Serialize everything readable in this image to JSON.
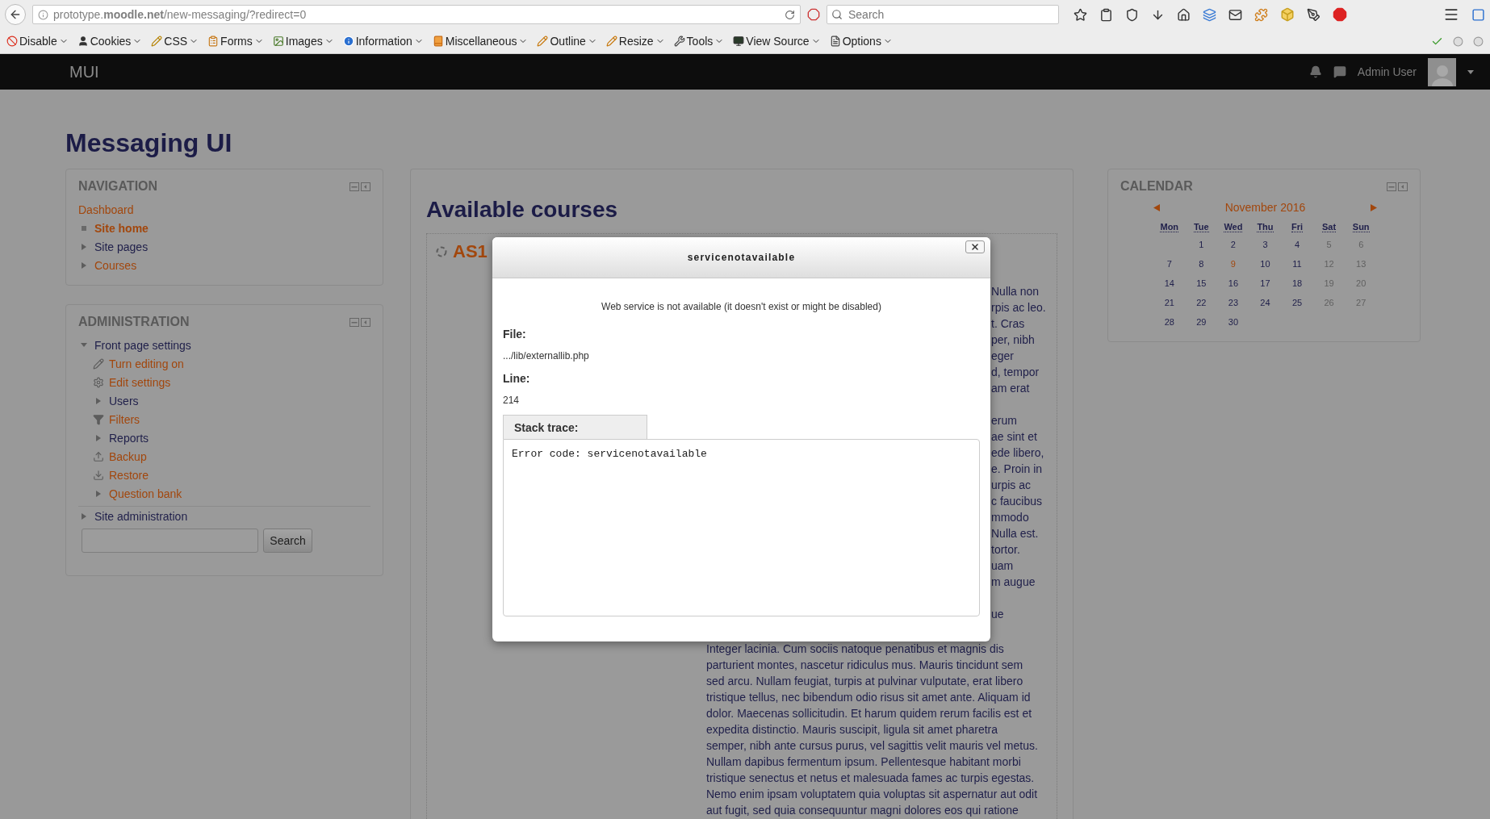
{
  "browser": {
    "url": "prototype.**moodle.net**/new-messaging/?redirect=0",
    "search_placeholder": "Search",
    "toolbar": [
      {
        "label": "Disable",
        "kind": "disable"
      },
      {
        "label": "Cookies",
        "kind": "cookies"
      },
      {
        "label": "CSS",
        "kind": "css"
      },
      {
        "label": "Forms",
        "kind": "forms"
      },
      {
        "label": "Images",
        "kind": "images"
      },
      {
        "label": "Information",
        "kind": "information"
      },
      {
        "label": "Miscellaneous",
        "kind": "misc"
      },
      {
        "label": "Outline",
        "kind": "outline"
      },
      {
        "label": "Resize",
        "kind": "resize"
      },
      {
        "label": "Tools",
        "kind": "tools"
      },
      {
        "label": "View Source",
        "kind": "source"
      },
      {
        "label": "Options",
        "kind": "options"
      }
    ]
  },
  "navbar": {
    "brand": "MUI",
    "user": "Admin User"
  },
  "page_title": "Messaging UI",
  "navigation": {
    "title": "NAVIGATION",
    "items": [
      {
        "label": "Dashboard",
        "kind": "plain",
        "link": true,
        "selected": false
      },
      {
        "label": "Site home",
        "kind": "leaf",
        "link": true,
        "selected": true
      },
      {
        "label": "Site pages",
        "kind": "branch",
        "link": false,
        "selected": false
      },
      {
        "label": "Courses",
        "kind": "branch",
        "link": true,
        "selected": false
      }
    ]
  },
  "administration": {
    "title": "ADMINISTRATION",
    "items": [
      {
        "label": "Front page settings",
        "kind": "branch",
        "link": false,
        "expanded": true,
        "children": [
          {
            "label": "Turn editing on",
            "kind": "edit",
            "link": true
          },
          {
            "label": "Edit settings",
            "kind": "settings",
            "link": true
          },
          {
            "label": "Users",
            "kind": "branch",
            "link": false,
            "expanded": false
          },
          {
            "label": "Filters",
            "kind": "filter",
            "link": true
          },
          {
            "label": "Reports",
            "kind": "branch",
            "link": false,
            "expanded": false
          },
          {
            "label": "Backup",
            "kind": "backup",
            "link": true
          },
          {
            "label": "Restore",
            "kind": "restore",
            "link": true
          },
          {
            "label": "Question bank",
            "kind": "branch",
            "link": true,
            "expanded": false
          }
        ]
      },
      {
        "label": "Site administration",
        "kind": "branch",
        "link": false,
        "expanded": false
      }
    ],
    "search_button": "Search"
  },
  "main": {
    "heading": "Available courses",
    "course": {
      "title": "AS1",
      "fragments": [
        [
          "Nulla non",
          "rpis ac leo.",
          "t. Cras",
          "per, nibh",
          "eger",
          "d, tempor",
          "am erat"
        ],
        [
          "erum",
          "ae sint et",
          "ede libero,",
          "e. Proin in",
          "urpis ac",
          "c faucibus",
          "mmodo",
          "Nulla est.",
          "tortor.",
          "uam",
          "m augue"
        ],
        [
          "ue"
        ]
      ],
      "paragraph": [
        "Integer lacinia. Cum sociis natoque penatibus et magnis dis",
        "parturient montes, nascetur ridiculus mus. Mauris tincidunt sem",
        "sed arcu. Nullam feugiat, turpis at pulvinar vulputate, erat libero",
        "tristique tellus, nec bibendum odio risus sit amet ante. Aliquam id",
        "dolor. Maecenas sollicitudin. Et harum quidem rerum facilis est et",
        "expedita distinctio. Mauris suscipit, ligula sit amet pharetra",
        "semper, nibh ante cursus purus, vel sagittis velit mauris vel metus.",
        "Nullam dapibus fermentum ipsum. Pellentesque habitant morbi",
        "tristique senectus et netus et malesuada fames ac turpis egestas.",
        "Nemo enim ipsam voluptatem quia voluptas sit aspernatur aut odit",
        "aut fugit, sed quia consequuntur magni dolores eos qui ratione"
      ]
    }
  },
  "calendar": {
    "title": "CALENDAR",
    "month": "November 2016",
    "weekdays": [
      "Mon",
      "Tue",
      "Wed",
      "Thu",
      "Fri",
      "Sat",
      "Sun"
    ],
    "weeks": [
      {
        "days": [
          {
            "label": "1",
            "today": false
          },
          {
            "label": "2",
            "today": false
          },
          {
            "label": "3",
            "today": false
          },
          {
            "label": "4",
            "today": false
          },
          {
            "label": "5",
            "today": false
          },
          {
            "label": "6",
            "today": false
          }
        ]
      },
      {
        "days": [
          {
            "label": "7",
            "today": false
          },
          {
            "label": "8",
            "today": false
          },
          {
            "label": "9",
            "today": true
          },
          {
            "label": "10",
            "today": false
          },
          {
            "label": "11",
            "today": false
          },
          {
            "label": "12",
            "today": false
          },
          {
            "label": "13",
            "today": false
          }
        ]
      },
      {
        "days": [
          {
            "label": "14",
            "today": false
          },
          {
            "label": "15",
            "today": false
          },
          {
            "label": "16",
            "today": false
          },
          {
            "label": "17",
            "today": false
          },
          {
            "label": "18",
            "today": false
          },
          {
            "label": "19",
            "today": false
          },
          {
            "label": "20",
            "today": false
          }
        ]
      },
      {
        "days": [
          {
            "label": "21",
            "today": false
          },
          {
            "label": "22",
            "today": false
          },
          {
            "label": "23",
            "today": false
          },
          {
            "label": "24",
            "today": false
          },
          {
            "label": "25",
            "today": false
          },
          {
            "label": "26",
            "today": false
          },
          {
            "label": "27",
            "today": false
          }
        ]
      },
      {
        "days": [
          {
            "label": "28",
            "today": false
          },
          {
            "label": "29",
            "today": false
          },
          {
            "label": "30",
            "today": false
          }
        ]
      }
    ]
  },
  "dialog": {
    "title": "servicenotavailable",
    "message": "Web service is not available (it doesn't exist or might be disabled)",
    "file_label": "File:",
    "file": ".../lib/externallib.php",
    "line_label": "Line:",
    "line": "214",
    "stack_trace_label": "Stack trace:",
    "stack_trace": "Error code: servicenotavailable"
  }
}
